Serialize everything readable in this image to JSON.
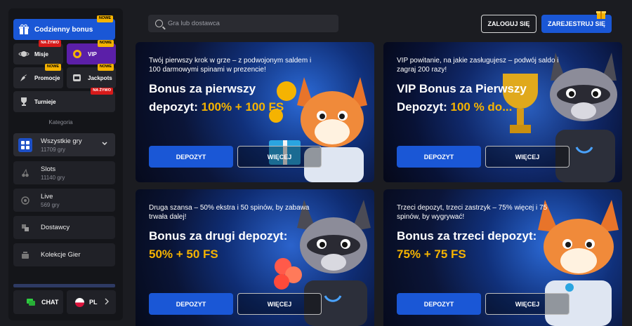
{
  "sidebar": {
    "daily_bonus": {
      "label": "Codzienny bonus",
      "badge": "NOWE"
    },
    "tiles": [
      {
        "label": "Misje",
        "badge": "NA ŻYWO"
      },
      {
        "label": "VIP",
        "badge": "NOWE"
      },
      {
        "label": "Promocje",
        "badge": "NOWE"
      },
      {
        "label": "Jackpots",
        "badge": "NOWE"
      },
      {
        "label": "Turnieje",
        "badge": "NA ŻYWO"
      }
    ],
    "category_title": "Kategoria",
    "categories": [
      {
        "name": "Wszystkie gry",
        "count": "11709 gry"
      },
      {
        "name": "Slots",
        "count": "11140 gry"
      },
      {
        "name": "Live",
        "count": "569 gry"
      },
      {
        "name": "Dostawcy",
        "count": ""
      },
      {
        "name": "Kolekcje Gier",
        "count": ""
      }
    ],
    "chat_label": "CHAT",
    "lang_label": "PL"
  },
  "header": {
    "search_placeholder": "Gra lub dostawca",
    "login_label": "ZALOGUJ SIĘ",
    "register_label": "ZAREJESTRUJ SIĘ"
  },
  "cards": [
    {
      "lead": "Twój pierwszy krok w grze – z podwojonym saldem i 100 darmowymi spinami w prezencie!",
      "title_line1": "Bonus za pierwszy",
      "title_line2_white": "depozyt: ",
      "title_line2_yellow": "100% + 100 FS",
      "deposit_label": "DEPOZYT",
      "more_label": "WIĘCEJ"
    },
    {
      "lead": "VIP powitanie, na jakie zasługujesz – podwój saldo i zagraj 200 razy!",
      "title_line1": "VIP Bonus za Pierwszy",
      "title_line2_white": "Depozyt: ",
      "title_line2_yellow": "100 % do...",
      "deposit_label": "DEPOZYT",
      "more_label": "WIĘCEJ"
    },
    {
      "lead": "Druga szansa – 50% ekstra i 50 spinów, by zabawa trwała dalej!",
      "title_line1": "Bonus za drugi depozyt:",
      "title_line2_white": "",
      "title_line2_yellow": "50% + 50 FS",
      "deposit_label": "DEPOZYT",
      "more_label": "WIĘCEJ"
    },
    {
      "lead": "Trzeci depozyt, trzeci zastrzyk – 75% więcej i 75 spinów, by wygrywać!",
      "title_line1": "Bonus za trzeci depozyt:",
      "title_line2_white": "",
      "title_line2_yellow": "75% + 75 FS",
      "deposit_label": "DEPOZYT",
      "more_label": "WIĘCEJ"
    }
  ],
  "colors": {
    "accent": "#1a57d6",
    "highlight": "#f5b301",
    "vip": "#5b1fa8",
    "badge_live": "#d71a1a"
  }
}
